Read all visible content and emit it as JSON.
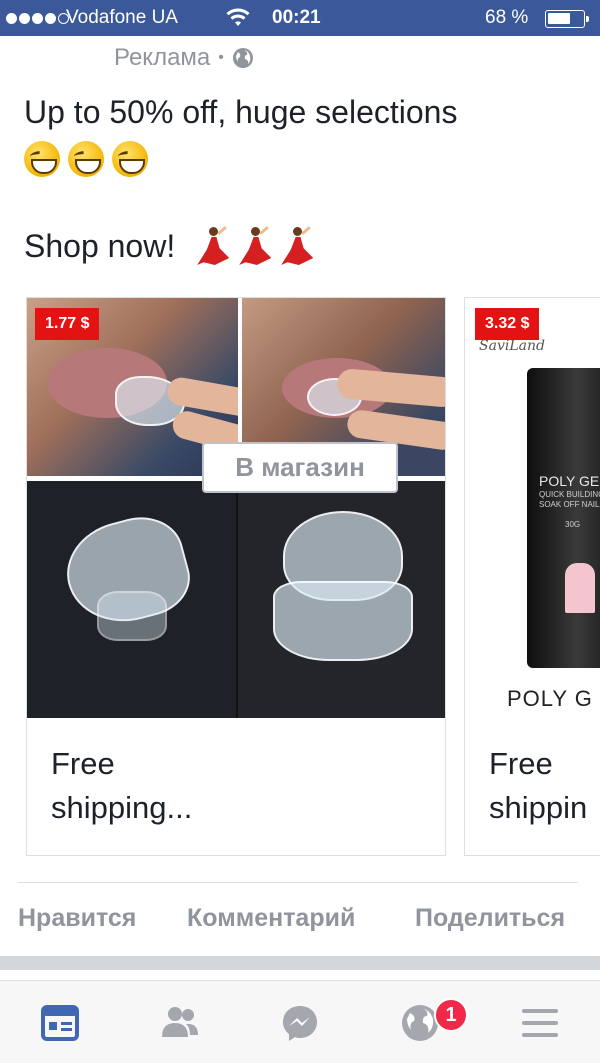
{
  "status_bar": {
    "signal_bars_filled": 4,
    "carrier": "Vodafone UA",
    "time": "00:21",
    "battery_percent": "68 %",
    "battery_level": 0.68
  },
  "post": {
    "sponsored_label": "Реклама",
    "sponsored_separator": "•",
    "headline": "Up to 50% off, huge selections",
    "shop_now": "Shop now!"
  },
  "carousel": [
    {
      "price": "1.77 $",
      "title": "Free shipping...",
      "button_label": "В магазин"
    },
    {
      "price": "3.32 $",
      "title": "Free shippin",
      "brand": "SaviLand",
      "product_label": "POLY GEL",
      "product_sub": "QUICK BUILDING SOAK OFF NAIL GEL",
      "weight": "30G",
      "caption": "POLY G"
    }
  ],
  "actions": {
    "like": "Нравится",
    "comment": "Комментарий",
    "share": "Поделиться"
  },
  "tabbar": {
    "notifications_badge": "1"
  },
  "colors": {
    "facebook_blue": "#3b5998",
    "badge_red": "#f02849",
    "price_red": "#e31313",
    "muted_text": "#90949c"
  },
  "icons": [
    "wifi-icon",
    "battery-icon",
    "globe-icon",
    "grinning-face-emoji",
    "flamenco-dancer-emoji",
    "news-feed-icon",
    "friends-icon",
    "messenger-icon",
    "notifications-globe-icon",
    "menu-icon"
  ]
}
